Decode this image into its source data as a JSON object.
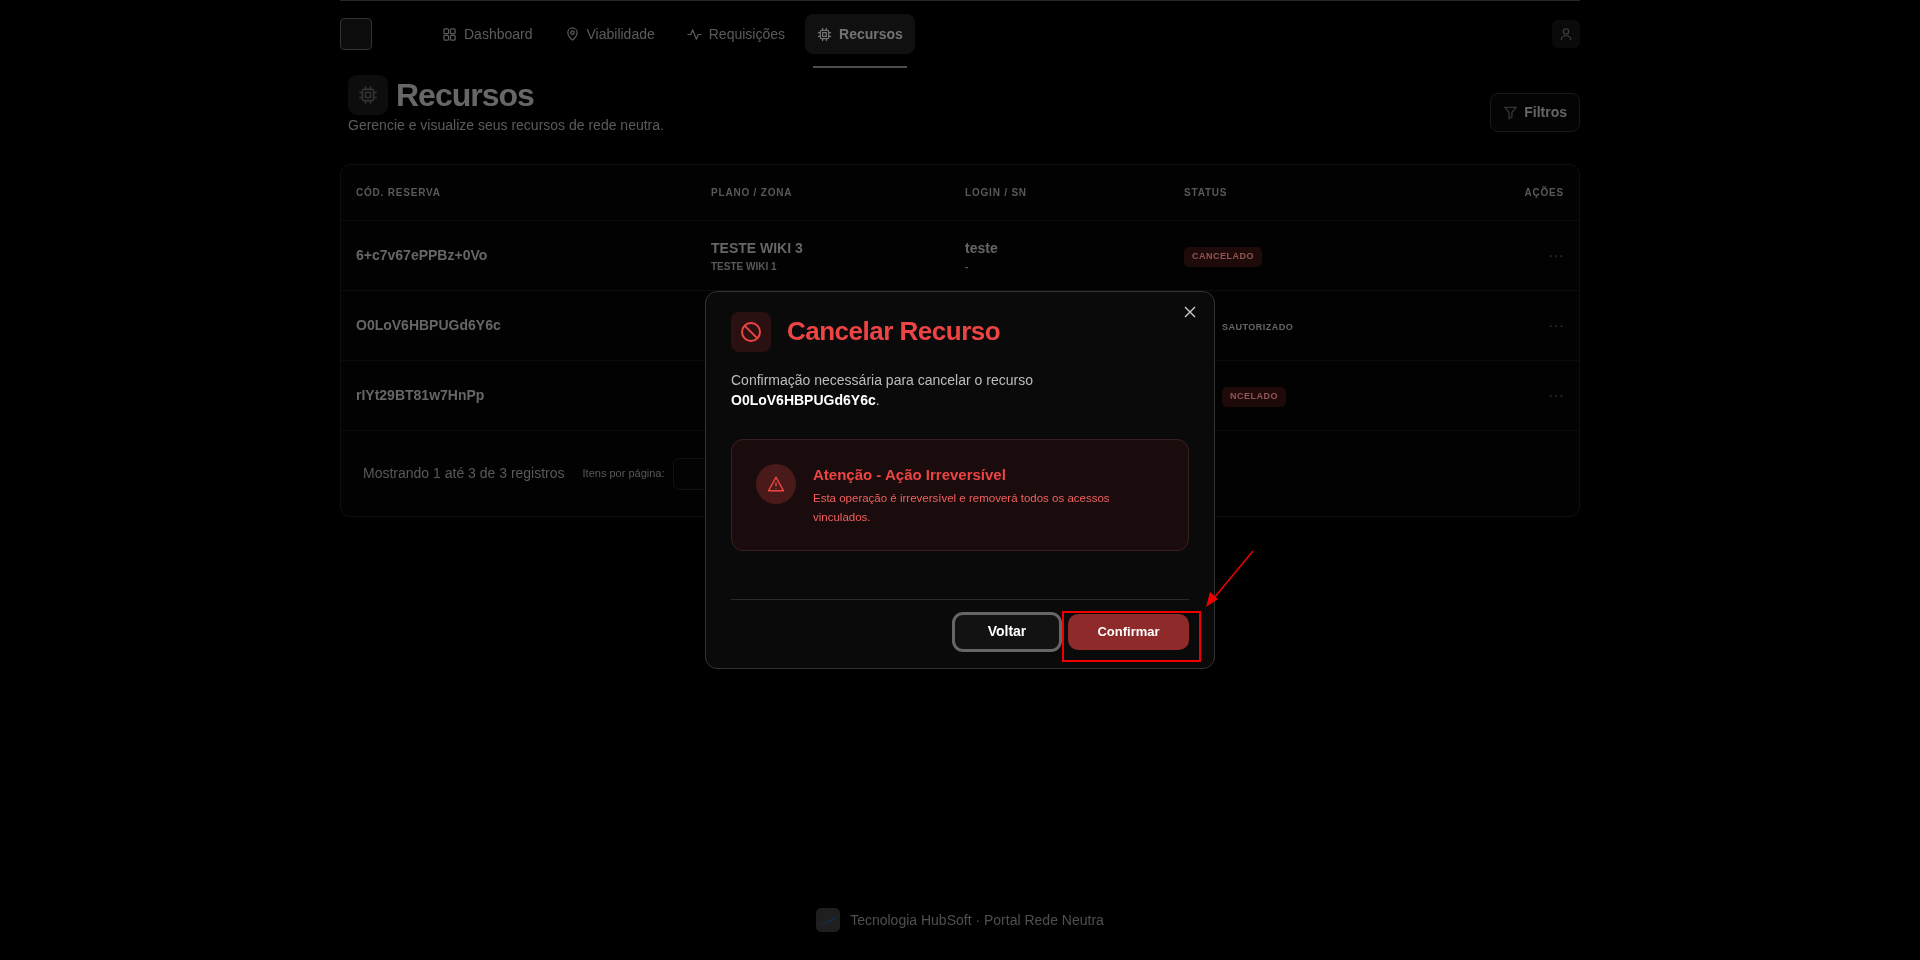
{
  "nav": {
    "tabs": [
      {
        "label": "Dashboard",
        "selected": false
      },
      {
        "label": "Viabilidade",
        "selected": false
      },
      {
        "label": "Requisições",
        "selected": false
      },
      {
        "label": "Recursos",
        "selected": true
      }
    ]
  },
  "header": {
    "title": "Recursos",
    "subtitle": "Gerencie e visualize seus recursos de rede neutra.",
    "filter_button": "Filtros"
  },
  "table": {
    "columns": [
      "CÓD. RESERVA",
      "PLANO / ZONA",
      "LOGIN / SN",
      "STATUS",
      "AÇÕES"
    ],
    "rows": [
      {
        "code": "6+c7v67ePPBz+0Vo",
        "plan": "TESTE WIKI 3",
        "zone": "TESTE WIKI 1",
        "login": "teste",
        "sn": "-",
        "status": "CANCELADO",
        "kind": "badge",
        "actions": "···"
      },
      {
        "code": "O0LoV6HBPUGd6Y6c",
        "status": "SAUTORIZADO",
        "kind": "plain",
        "actions": "···"
      },
      {
        "code": "rIYt29BT81w7HnPp",
        "status": "NCELADO",
        "kind": "badge",
        "actions": "···"
      }
    ],
    "footer": {
      "summary": "Mostrando 1 até 3 de 3 registros",
      "per_page_label": "Itens por página:"
    }
  },
  "modal": {
    "title": "Cancelar Recurso",
    "message": "Confirmação necessária para cancelar o recurso",
    "resource_code": "O0LoV6HBPUGd6Y6c",
    "message_end": ".",
    "alert": {
      "title": "Atenção - Ação Irreversível",
      "text": "Esta operação é irreversível e removerá todos os acessos vinculados."
    },
    "buttons": [
      {
        "label": "Voltar",
        "kind": "secondary"
      },
      {
        "label": "Confirmar",
        "kind": "danger"
      }
    ]
  },
  "footer": {
    "text": "Tecnologia HubSoft · Portal Rede Neutra"
  }
}
